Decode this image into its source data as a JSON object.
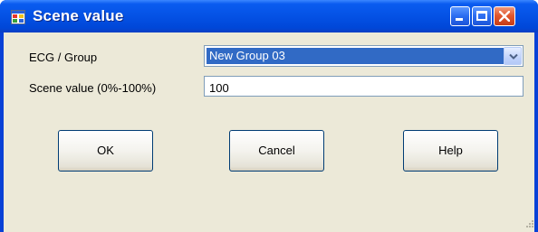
{
  "window": {
    "title": "Scene value",
    "app_icon": "app-window-icon",
    "controls": [
      "minimize-icon",
      "maximize-icon",
      "close-icon"
    ]
  },
  "form": {
    "group_label": "ECG / Group",
    "group_selected": "New Group 03",
    "scene_label": "Scene value (0%-100%)",
    "scene_value": "100"
  },
  "buttons": {
    "ok": "OK",
    "cancel": "Cancel",
    "help": "Help"
  },
  "colors": {
    "titlebar": "#0553e6",
    "client_bg": "#ece9d8",
    "selection": "#316ac5",
    "close_button": "#e2582f"
  }
}
